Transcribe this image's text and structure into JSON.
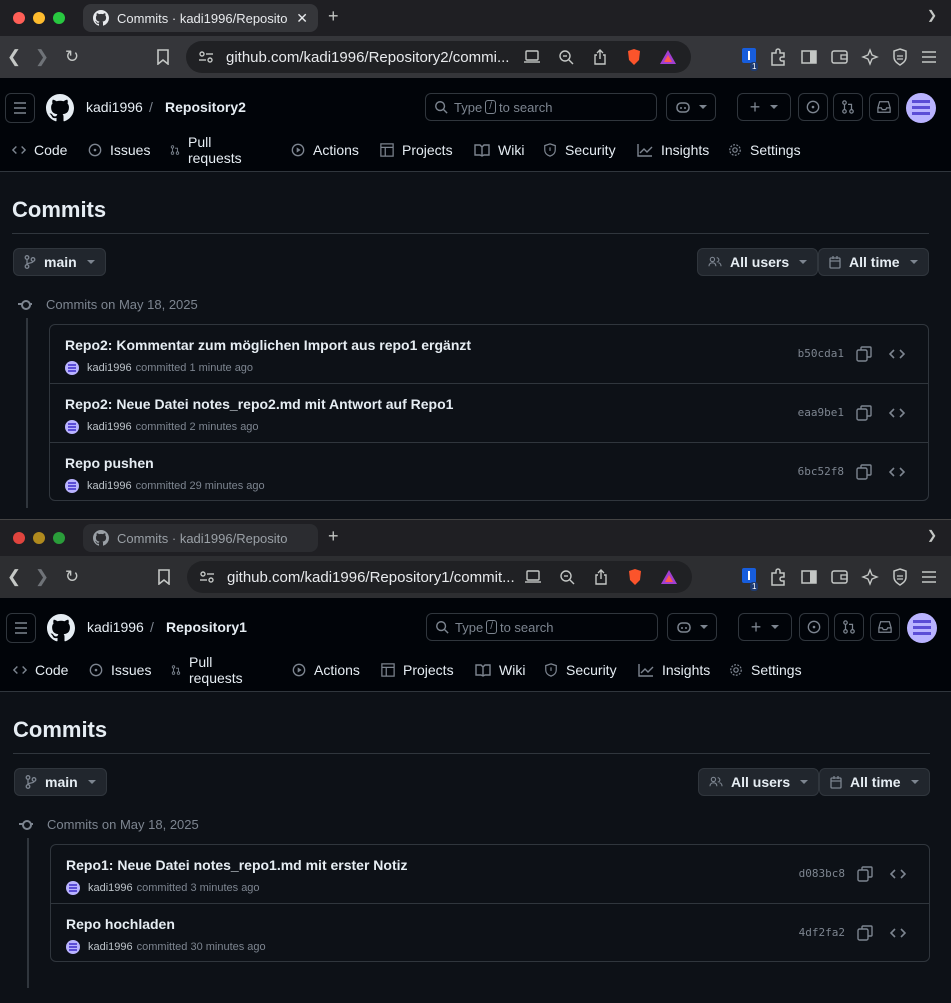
{
  "windows": [
    {
      "tab_title": "Commits · kadi1996/Reposito",
      "url": "github.com/kadi1996/Repository2/commi...",
      "owner": "kadi1996",
      "repo": "Repository2",
      "search_prefix": "Type",
      "search_key": "/",
      "search_suffix": "to search",
      "nav": [
        "Code",
        "Issues",
        "Pull requests",
        "Actions",
        "Projects",
        "Wiki",
        "Security",
        "Insights",
        "Settings"
      ],
      "page_title": "Commits",
      "branch": "main",
      "users_filter": "All users",
      "time_filter": "All time",
      "group_label": "Commits on May 18, 2025",
      "commits": [
        {
          "message": "Repo2: Kommentar zum möglichen Import aus repo1 ergänzt",
          "author": "kadi1996",
          "when": "committed 1 minute ago",
          "sha": "b50cda1"
        },
        {
          "message": "Repo2: Neue Datei notes_repo2.md mit Antwort auf Repo1",
          "author": "kadi1996",
          "when": "committed 2 minutes ago",
          "sha": "eaa9be1"
        },
        {
          "message": "Repo pushen",
          "author": "kadi1996",
          "when": "committed 29 minutes ago",
          "sha": "6bc52f8"
        }
      ]
    },
    {
      "tab_title": "Commits · kadi1996/Reposito",
      "url": "github.com/kadi1996/Repository1/commit...",
      "owner": "kadi1996",
      "repo": "Repository1",
      "search_prefix": "Type",
      "search_key": "/",
      "search_suffix": "to search",
      "nav": [
        "Code",
        "Issues",
        "Pull requests",
        "Actions",
        "Projects",
        "Wiki",
        "Security",
        "Insights",
        "Settings"
      ],
      "page_title": "Commits",
      "branch": "main",
      "users_filter": "All users",
      "time_filter": "All time",
      "group_label": "Commits on May 18, 2025",
      "commits": [
        {
          "message": "Repo1: Neue Datei notes_repo1.md mit erster Notiz",
          "author": "kadi1996",
          "when": "committed 3 minutes ago",
          "sha": "d083bc8"
        },
        {
          "message": "Repo hochladen",
          "author": "kadi1996",
          "when": "committed 30 minutes ago",
          "sha": "4df2fa2"
        }
      ]
    }
  ],
  "extension_badge": "1",
  "colors": {
    "bg": "#0d1117",
    "header": "#010409",
    "border": "#30363d",
    "muted": "#7d8590",
    "text": "#e6edf3"
  }
}
